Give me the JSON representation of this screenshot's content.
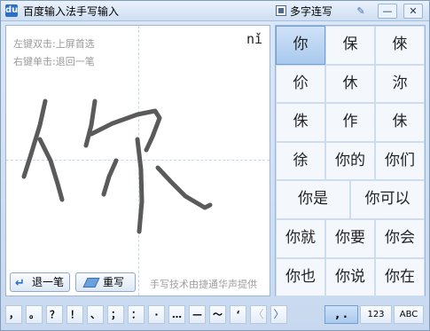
{
  "window": {
    "app_icon": "du",
    "title": "百度输入法手写输入",
    "multi_char_label": "多字连写",
    "pin_icon": "✎",
    "minimize_icon": "—",
    "close_icon": "✕"
  },
  "pad": {
    "hint_double_click": "左键双击:上屏首选",
    "hint_right_click": "右键单击:退回一笔",
    "pinyin": "nǐ",
    "undo_label": "退一笔",
    "rewrite_label": "重写",
    "credit": "手写技术由捷通华声提供"
  },
  "candidates": [
    "你",
    "保",
    "倈",
    "伱",
    "休",
    "沵",
    "侏",
    "作",
    "佅",
    "徐",
    "你的",
    "你们",
    "你是",
    "你可以",
    "你就",
    "你要",
    "你会",
    "你也",
    "你说",
    "你在"
  ],
  "toolbar": {
    "punctuation": [
      "，",
      "。",
      "？",
      "！",
      "、",
      "；",
      "：",
      "·",
      "…",
      "—",
      "～",
      "‘"
    ],
    "prev_icon": "〈",
    "next_icon": "〉",
    "modes": [
      ", .",
      "123",
      "ABC"
    ]
  },
  "colors": {
    "accent": "#2d6fc7",
    "ink": "#5a5a5a",
    "selected": "#a9c9ee"
  }
}
